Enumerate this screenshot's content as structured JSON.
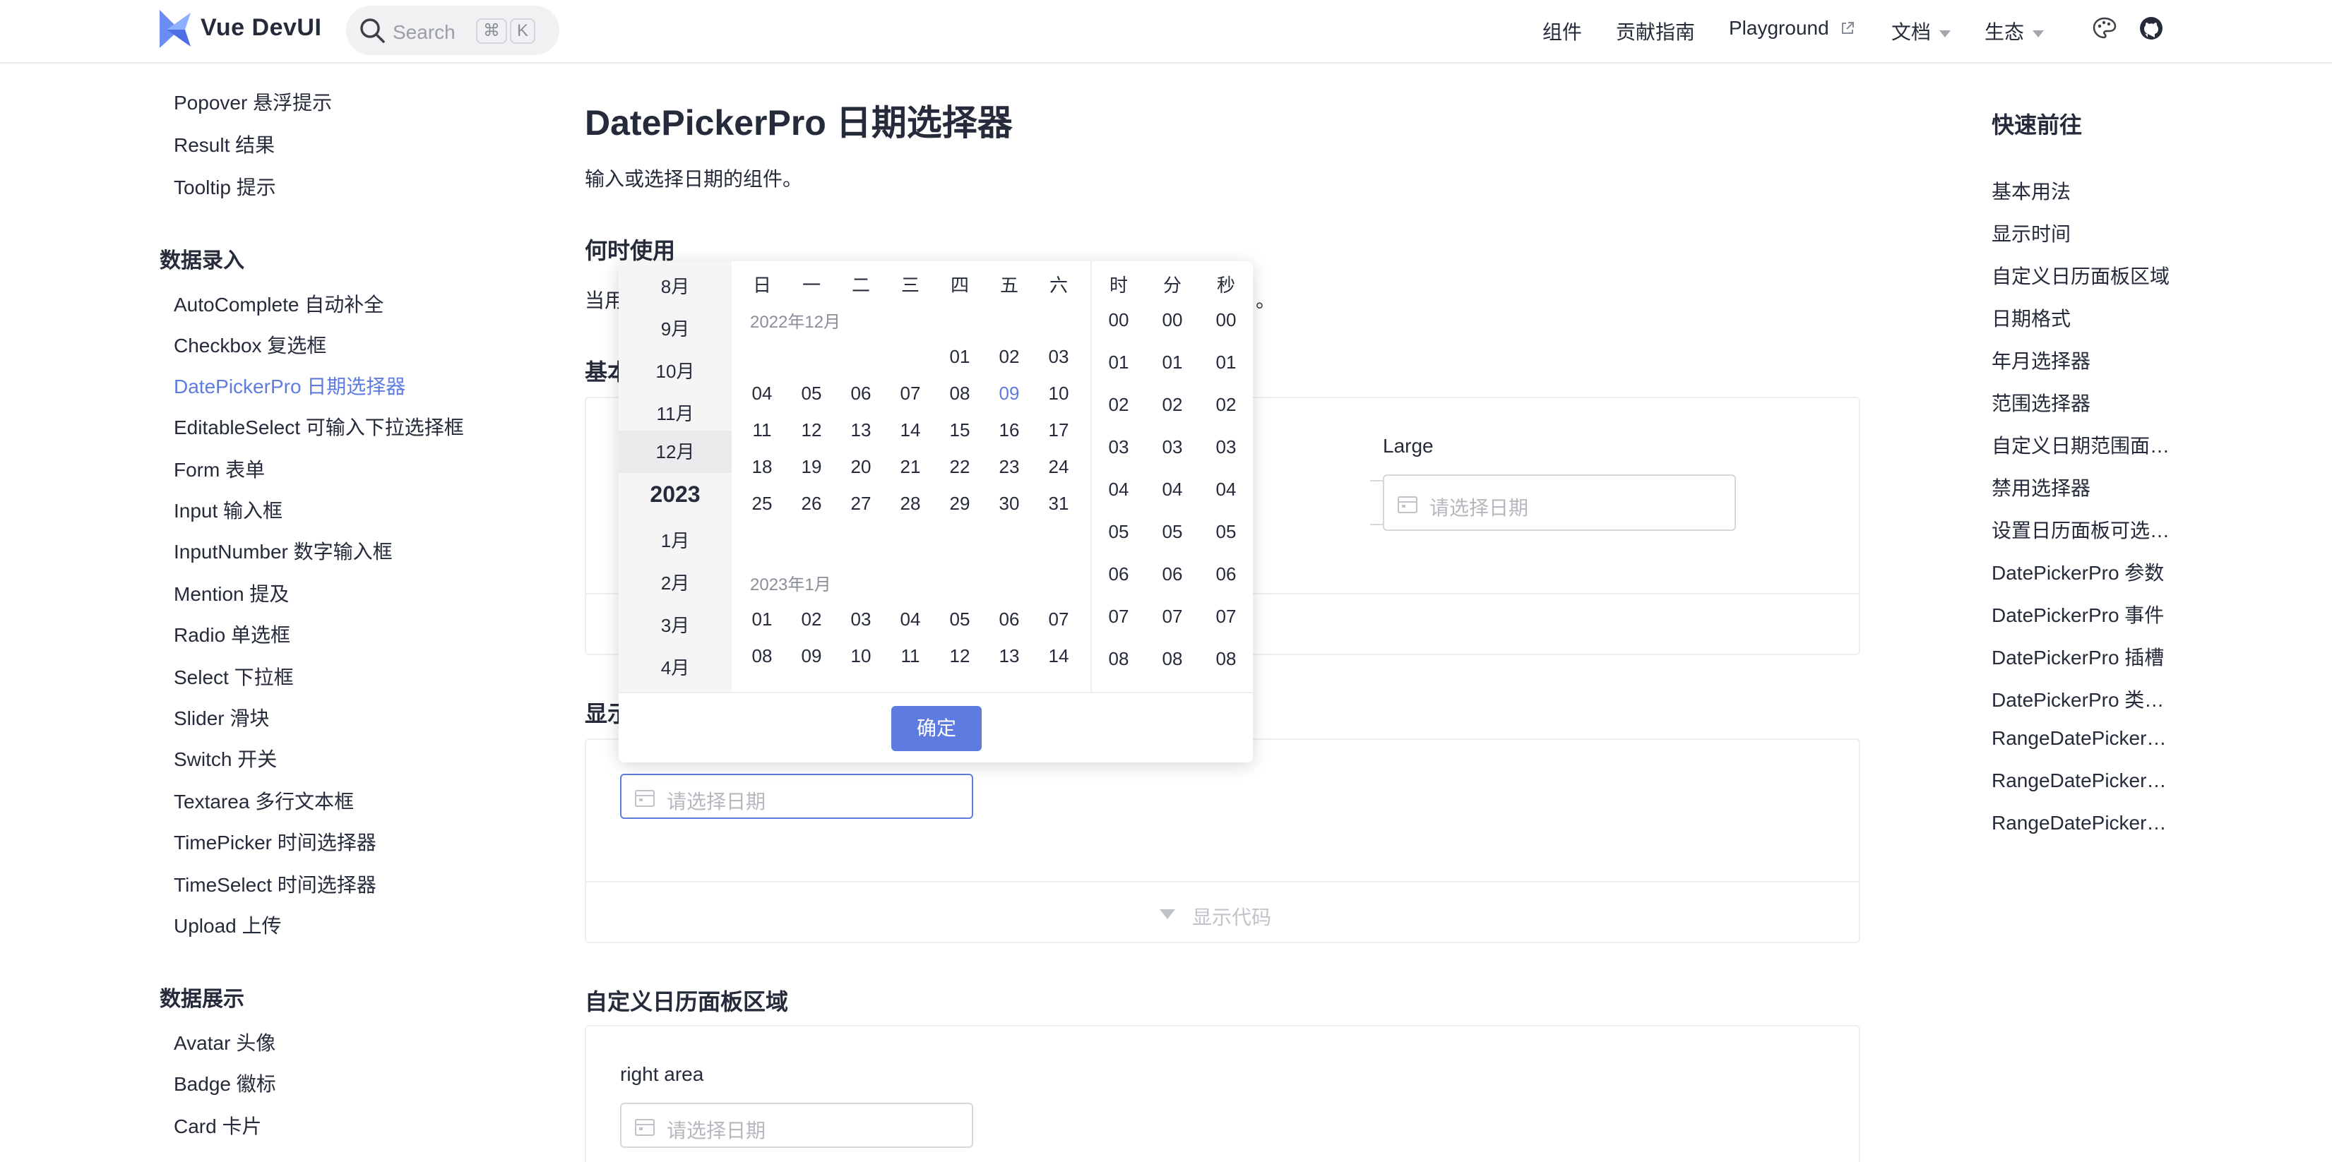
{
  "header": {
    "brand": "Vue DevUI",
    "search_placeholder": "Search",
    "kbd_cmd": "⌘",
    "kbd_k": "K",
    "nav": [
      {
        "label": "组件"
      },
      {
        "label": "贡献指南"
      },
      {
        "label": "Playground"
      },
      {
        "label": "文档"
      },
      {
        "label": "生态"
      }
    ]
  },
  "sidebar": {
    "top_items": [
      "Popover 悬浮提示",
      "Result 结果",
      "Tooltip 提示"
    ],
    "group_input": "数据录入",
    "input_items": [
      "AutoComplete 自动补全",
      "Checkbox 复选框",
      "DatePickerPro 日期选择器",
      "EditableSelect 可输入下拉选择框",
      "Form 表单",
      "Input 输入框",
      "InputNumber 数字输入框",
      "Mention 提及",
      "Radio 单选框",
      "Select 下拉框",
      "Slider 滑块",
      "Switch 开关",
      "Textarea 多行文本框",
      "TimePicker 时间选择器",
      "TimeSelect 时间选择器",
      "Upload 上传"
    ],
    "group_display": "数据展示",
    "display_items": [
      "Avatar 头像",
      "Badge 徽标",
      "Card 卡片"
    ]
  },
  "main": {
    "title": "DatePickerPro 日期选择器",
    "description": "输入或选择日期的组件。",
    "when_title": "何时使用",
    "when_text_start": "当用",
    "when_text_end": "。",
    "basic_title_partial": "基本",
    "basic_large_label": "Large",
    "show_time_title_partial": "显示",
    "show_code": "显示代码",
    "custom_title": "自定义日历面板区域",
    "custom_label": "right area",
    "input_placeholder": "请选择日期"
  },
  "toc": {
    "title": "快速前往",
    "items": [
      "基本用法",
      "显示时间",
      "自定义日历面板区域",
      "日期格式",
      "年月选择器",
      "范围选择器",
      "自定义日期范围面…",
      "禁用选择器",
      "设置日历面板可选…",
      "DatePickerPro 参数",
      "DatePickerPro 事件",
      "DatePickerPro 插槽",
      "DatePickerPro 类型…",
      "RangeDatePickerPr…",
      "RangeDatePickerPr…",
      "RangeDatePickerPr…"
    ]
  },
  "picker": {
    "months_before": [
      "8月",
      "9月",
      "10月",
      "11月",
      "12月"
    ],
    "year": "2023",
    "months_after": [
      "1月",
      "2月",
      "3月",
      "4月"
    ],
    "weekdays": [
      "日",
      "一",
      "二",
      "三",
      "四",
      "五",
      "六"
    ],
    "month1_title": "2022年12月",
    "month1_rows": [
      [
        "",
        "",
        "",
        "",
        "01",
        "02",
        "03"
      ],
      [
        "04",
        "05",
        "06",
        "07",
        "08",
        "09",
        "10"
      ],
      [
        "11",
        "12",
        "13",
        "14",
        "15",
        "16",
        "17"
      ],
      [
        "18",
        "19",
        "20",
        "21",
        "22",
        "23",
        "24"
      ],
      [
        "25",
        "26",
        "27",
        "28",
        "29",
        "30",
        "31"
      ]
    ],
    "month2_title": "2023年1月",
    "month2_rows": [
      [
        "01",
        "02",
        "03",
        "04",
        "05",
        "06",
        "07"
      ],
      [
        "08",
        "09",
        "10",
        "11",
        "12",
        "13",
        "14"
      ]
    ],
    "today": "09",
    "time_heads": [
      "时",
      "分",
      "秒"
    ],
    "time_values": [
      "00",
      "01",
      "02",
      "03",
      "04",
      "05",
      "06",
      "07",
      "08"
    ],
    "confirm": "确定"
  },
  "colors": {
    "accent": "#5e7ce0",
    "text": "#252b3a",
    "placeholder": "#b5b8be",
    "border": "#d7d8da"
  }
}
